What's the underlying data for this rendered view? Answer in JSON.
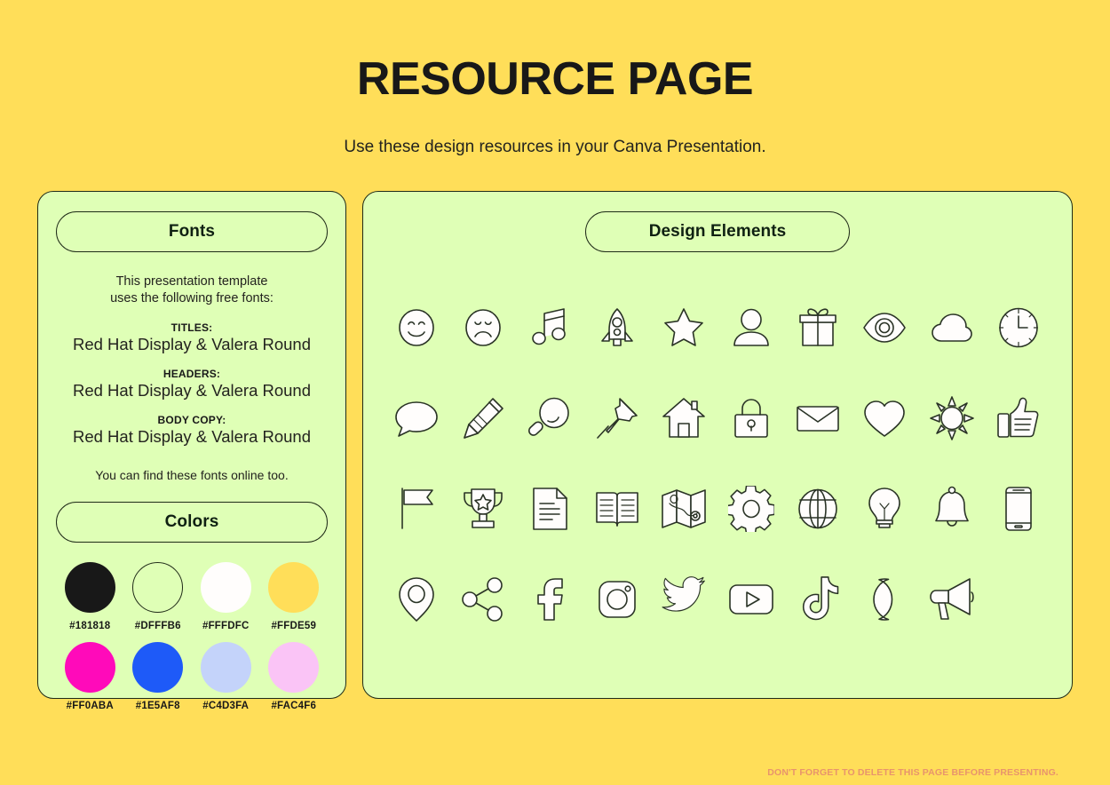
{
  "header": {
    "title": "RESOURCE PAGE",
    "subtitle": "Use these design resources in your Canva Presentation."
  },
  "fonts_panel": {
    "pill_label": "Fonts",
    "intro_line1": "This presentation template",
    "intro_line2": "uses the following free fonts:",
    "entries": [
      {
        "label": "TITLES:",
        "value": "Red Hat Display & Valera Round"
      },
      {
        "label": "HEADERS:",
        "value": "Red Hat Display & Valera Round"
      },
      {
        "label": "BODY COPY:",
        "value": "Red Hat Display & Valera Round"
      }
    ],
    "outro": "You can find these fonts online too."
  },
  "colors_panel": {
    "pill_label": "Colors",
    "swatches": [
      {
        "hex": "#181818",
        "outlined": false
      },
      {
        "hex": "#DFFFB6",
        "outlined": true
      },
      {
        "hex": "#FFFDFC",
        "outlined": false
      },
      {
        "hex": "#FFDE59",
        "outlined": false
      },
      {
        "hex": "#FF0ABA",
        "outlined": false
      },
      {
        "hex": "#1E5AF8",
        "outlined": false
      },
      {
        "hex": "#C4D3FA",
        "outlined": false
      },
      {
        "hex": "#FAC4F6",
        "outlined": false
      }
    ]
  },
  "elements_panel": {
    "pill_label": "Design Elements",
    "icons": [
      "smiley-face-icon",
      "sad-face-icon",
      "music-note-icon",
      "rocket-icon",
      "star-icon",
      "person-icon",
      "gift-icon",
      "eye-icon",
      "cloud-icon",
      "clock-icon",
      "speech-bubble-icon",
      "pencil-icon",
      "magnifier-icon",
      "pushpin-icon",
      "house-icon",
      "lock-icon",
      "envelope-icon",
      "heart-icon",
      "sun-icon",
      "thumbs-up-icon",
      "flag-icon",
      "trophy-icon",
      "document-icon",
      "book-icon",
      "map-icon",
      "gear-icon",
      "globe-icon",
      "lightbulb-icon",
      "bell-icon",
      "phone-icon",
      "location-pin-icon",
      "share-icon",
      "facebook-icon",
      "instagram-icon",
      "twitter-icon",
      "youtube-icon",
      "tiktok-icon",
      "moon-icon",
      "megaphone-icon"
    ]
  },
  "footer": {
    "note": "DON'T FORGET TO DELETE THIS PAGE BEFORE PRESENTING.",
    "note_color": "#E8946C"
  },
  "theme": {
    "background": "#FFDE59",
    "panel_background": "#DFFFB6",
    "outline": "#1F2B18",
    "text": "#181818"
  }
}
